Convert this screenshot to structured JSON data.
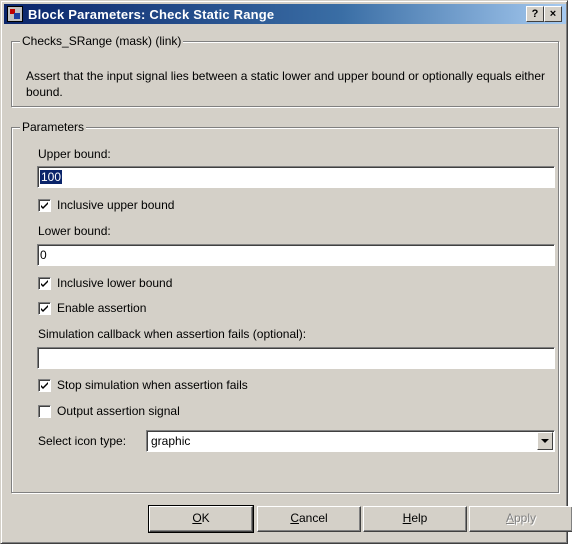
{
  "window": {
    "title": "Block Parameters: Check  Static Range",
    "help_glyph": "?",
    "close_glyph": "×",
    "app_icon": "simulink-block-icon"
  },
  "description_group": {
    "label": "Checks_SRange (mask) (link)",
    "text": "Assert that the input signal lies between a static lower and upper bound or optionally equals either bound."
  },
  "parameters": {
    "label": "Parameters",
    "upper_bound_label": "Upper bound:",
    "upper_bound_value": "100",
    "inclusive_upper_label": "Inclusive upper bound",
    "inclusive_upper_checked": true,
    "lower_bound_label": "Lower bound:",
    "lower_bound_value": "0",
    "inclusive_lower_label": "Inclusive lower bound",
    "inclusive_lower_checked": true,
    "enable_assertion_label": "Enable assertion",
    "enable_assertion_checked": true,
    "callback_label": "Simulation callback when assertion fails (optional):",
    "callback_value": "",
    "stop_sim_label": "Stop simulation when assertion fails",
    "stop_sim_checked": true,
    "output_signal_label": "Output assertion signal",
    "output_signal_checked": false,
    "icon_type_label": "Select icon type:",
    "icon_type_value": "graphic"
  },
  "buttons": {
    "ok": {
      "first": "O",
      "rest": "K"
    },
    "cancel": {
      "first": "C",
      "rest": "ancel"
    },
    "help": {
      "first": "H",
      "rest": "elp"
    },
    "apply": {
      "first": "A",
      "rest": "pply"
    }
  }
}
